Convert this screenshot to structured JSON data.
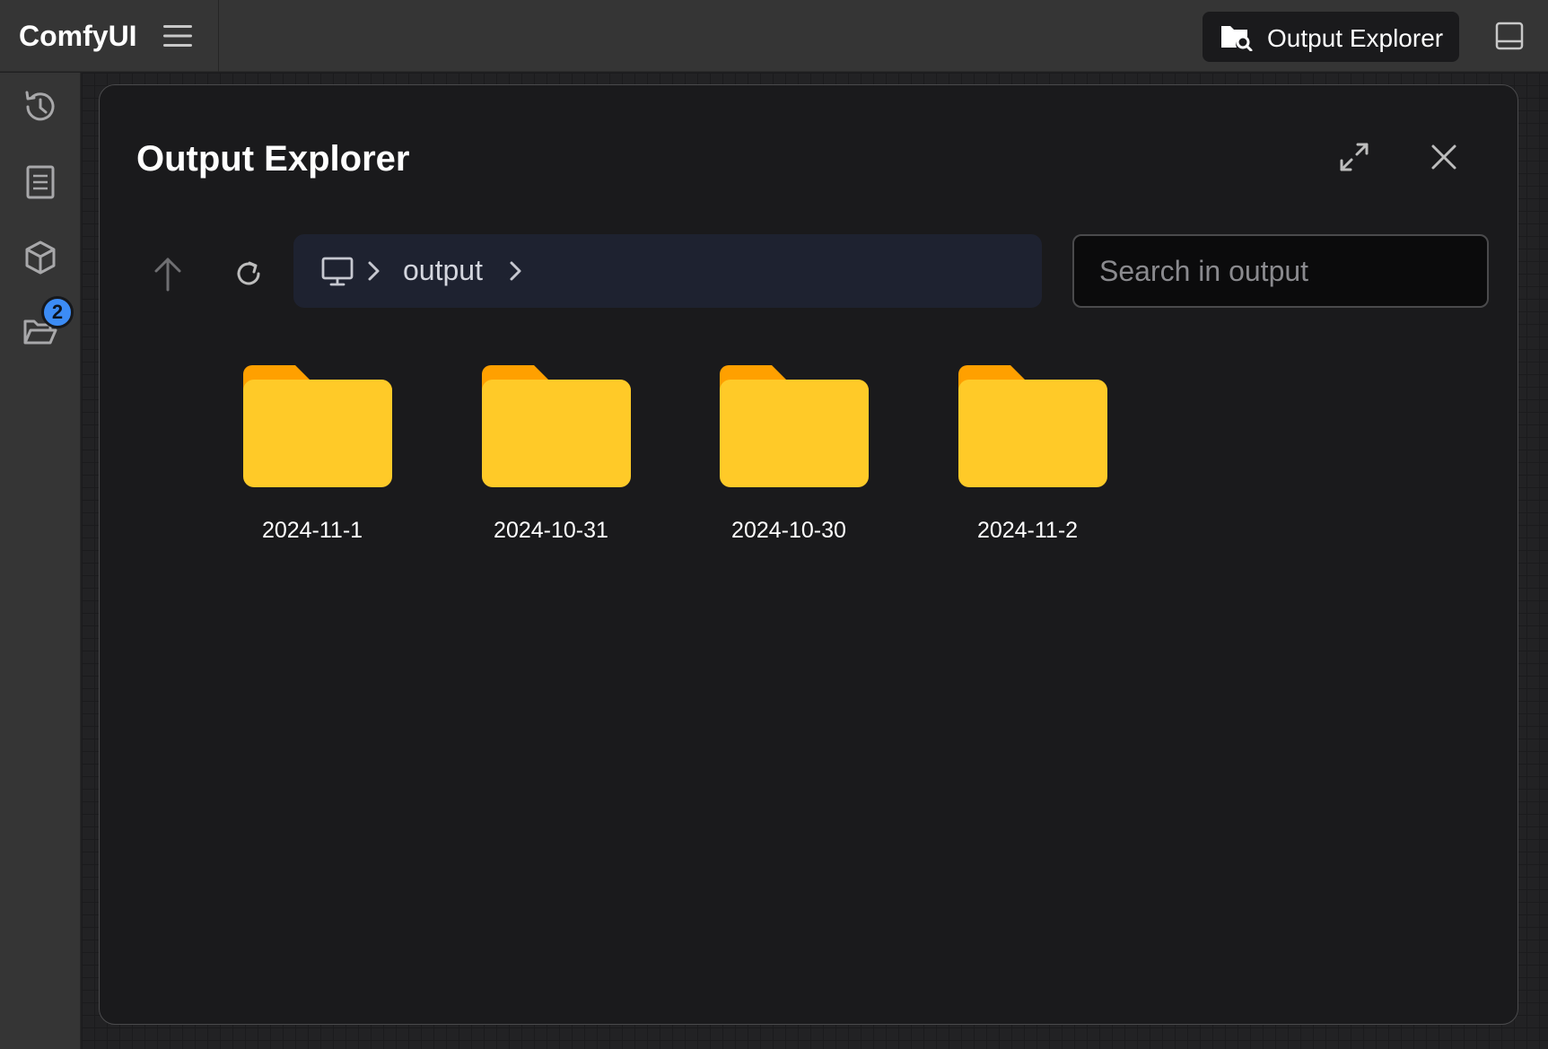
{
  "app": {
    "title": "ComfyUI",
    "accent_color": "#3c8cf5"
  },
  "topbar": {
    "menu_icon": "hamburger-menu-icon",
    "explorer_button_label": "Output Explorer",
    "explorer_icon": "folder-search-icon",
    "panel_toggle_icon": "bottom-panel-icon"
  },
  "sidebar": {
    "items": [
      {
        "name": "history",
        "icon": "history-icon"
      },
      {
        "name": "workflows",
        "icon": "document-icon"
      },
      {
        "name": "models",
        "icon": "cube-icon"
      },
      {
        "name": "output-explorer",
        "icon": "folder-open-icon",
        "badge": "2"
      }
    ]
  },
  "dialog": {
    "title": "Output Explorer",
    "maximize_icon": "maximize-icon",
    "close_icon": "close-icon",
    "toolbar": {
      "up_icon": "arrow-up-icon",
      "refresh_icon": "refresh-icon"
    },
    "breadcrumb": {
      "root_icon": "monitor-icon",
      "items": [
        "output"
      ]
    },
    "search": {
      "placeholder": "Search in output",
      "value": ""
    },
    "folders": [
      {
        "name": "2024-11-1"
      },
      {
        "name": "2024-10-31"
      },
      {
        "name": "2024-10-30"
      },
      {
        "name": "2024-11-2"
      }
    ],
    "folder_colors": {
      "front": "#ffca28",
      "back": "#ffa000"
    }
  }
}
